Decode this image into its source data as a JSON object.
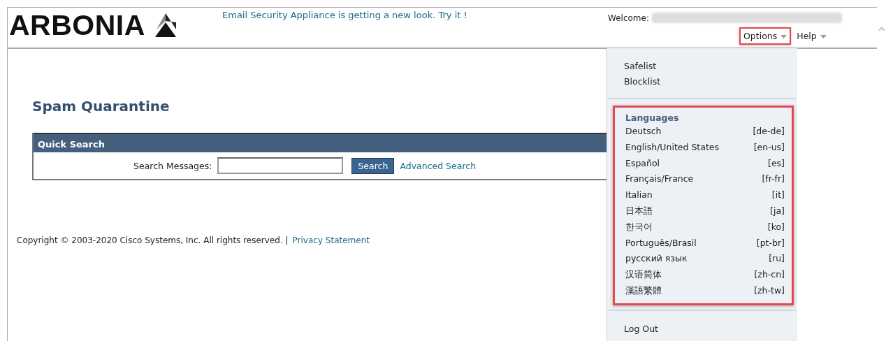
{
  "header": {
    "logo": "ARBONIA",
    "notice": "Email Security Appliance is getting a new look. Try it !",
    "welcome_label": "Welcome:",
    "nav": [
      {
        "label": "Options",
        "highlighted": true
      },
      {
        "label": "Help",
        "highlighted": false
      }
    ]
  },
  "page_title": "Spam Quarantine",
  "quick_search": {
    "title": "Quick Search",
    "label": "Search Messages:",
    "button": "Search",
    "link": "Advanced Search"
  },
  "footer": {
    "copyright": "Copyright © 2003-2020 Cisco Systems, Inc. All rights reserved. |",
    "link": "Privacy Statement"
  },
  "options_menu": {
    "open": true,
    "lists": [
      "Safelist",
      "Blocklist"
    ],
    "languages": {
      "title": "Languages",
      "highlighted": true,
      "items": [
        {
          "name": "Deutsch",
          "code": "[de-de]"
        },
        {
          "name": "English/United States",
          "code": "[en-us]"
        },
        {
          "name": "Español",
          "code": "[es]"
        },
        {
          "name": "Français/France",
          "code": "[fr-fr]"
        },
        {
          "name": "Italian",
          "code": "[it]"
        },
        {
          "name": "日本語",
          "code": "[ja]"
        },
        {
          "name": "한국어",
          "code": "[ko]"
        },
        {
          "name": "Português/Brasil",
          "code": "[pt-br]"
        },
        {
          "name": "русский язык",
          "code": "[ru]"
        },
        {
          "name": "汉语简体",
          "code": "[zh-cn]"
        },
        {
          "name": "漢語繁體",
          "code": "[zh-tw]"
        }
      ]
    },
    "logout": "Log Out"
  }
}
